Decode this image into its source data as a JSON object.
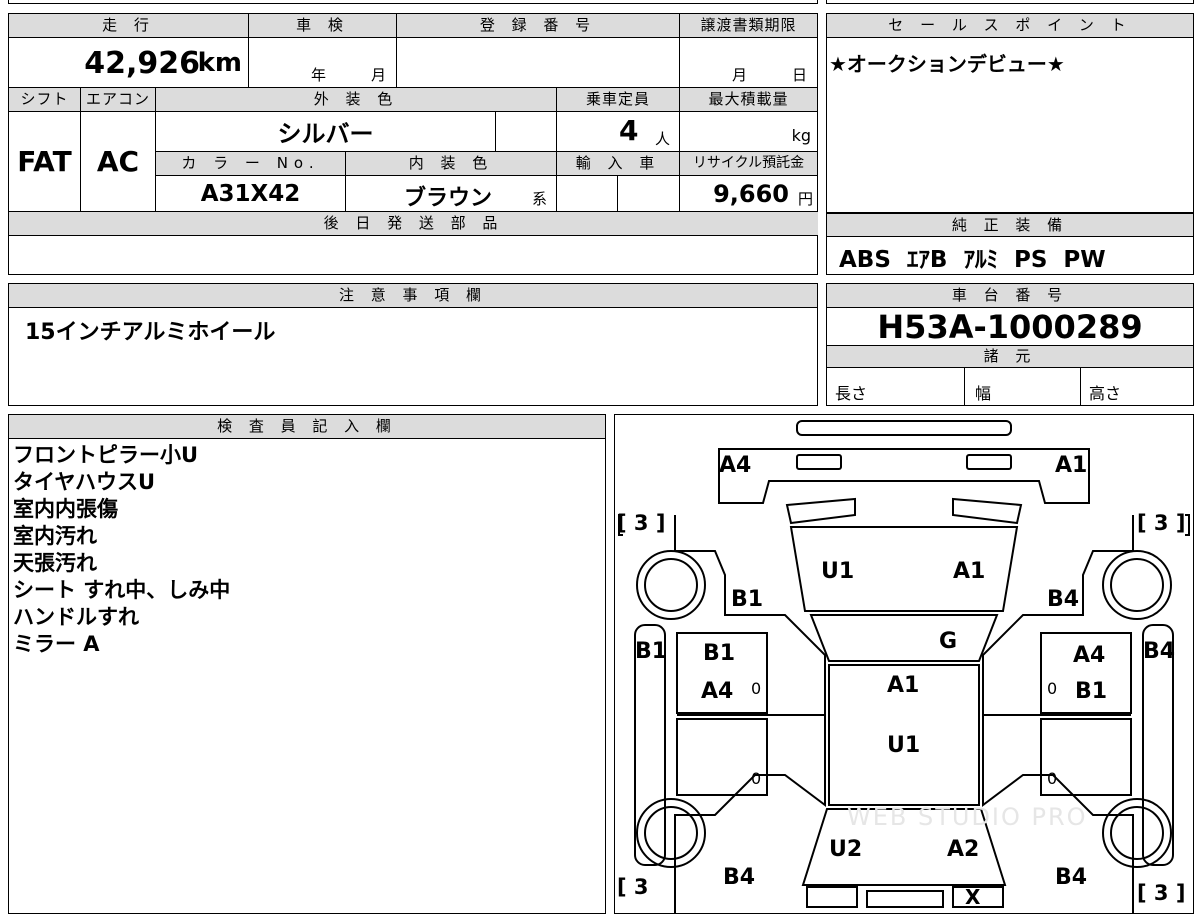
{
  "top_info": {
    "mileage_label": "走 行",
    "mileage": "42,926",
    "mileage_unit": "km",
    "shaken_label": "車 検",
    "year_label": "年",
    "month_label": "月",
    "reg_label": "登 録 番 号",
    "transfer_label": "譲渡書類期限",
    "transfer_month": "月",
    "transfer_day": "日",
    "shift_label": "シフト",
    "shift": "FAT",
    "ac_label": "エアコン",
    "ac": "AC",
    "exterior_label": "外 装 色",
    "exterior_color": "シルバー",
    "capacity_label": "乗車定員",
    "capacity": "4",
    "capacity_unit": "人",
    "max_load_label": "最大積載量",
    "max_load_unit": "kg",
    "color_no_label": "カ ラ ー No.",
    "color_no": "A31X42",
    "interior_label": "内 装 色",
    "interior_color": "ブラウン",
    "interior_suffix": "系",
    "import_label": "輸 入 車",
    "recycle_label": "リサイクル預託金",
    "recycle_fee": "9,660",
    "recycle_unit": "円",
    "later_parts_label": "後 日 発 送 部 品"
  },
  "sales_point": {
    "label": "セ ー ル ス ポ イ ン ト",
    "text": "★オークションデビュー★"
  },
  "standard_equipment": {
    "label": "純 正 装 備",
    "text": "ABS  ｴｱB  ｱﾙﾐ  PS  PW"
  },
  "notes": {
    "label": "注 意 事 項 欄",
    "text": "15インチアルミホイール"
  },
  "chassis": {
    "label": "車 台 番 号",
    "number": "H53A-1000289",
    "spec_label": "諸 元",
    "length_label": "長さ",
    "width_label": "幅",
    "height_label": "高さ"
  },
  "inspector": {
    "label": "検 査 員 記 入 欄",
    "items": [
      "フロントピラー小U",
      "タイヤハウスU",
      "室内内張傷",
      "室内汚れ",
      "天張汚れ",
      "シート すれ中、しみ中",
      "ハンドルすれ",
      "ミラー A"
    ]
  },
  "diagram": {
    "front_left": "A4",
    "front_right": "A1",
    "tread_fl": "[ 3 ]",
    "tread_fr": "[ 3 ]",
    "tread_rl": "[ 3",
    "tread_rr": "[ 3 ]",
    "hood_left": "U1",
    "hood_right": "A1",
    "fender_left": "B1",
    "fender_right": "B4",
    "windshield": "G",
    "pillar_left": "B1",
    "pillar_right": "B4",
    "door_fl_1": "B1",
    "door_fl_2": "A4",
    "door_fr_1": "A4",
    "door_fr_2": "B1",
    "roof_1": "A1",
    "roof_2": "U1",
    "zero_1": "0",
    "zero_2": "0",
    "zero_3": "0",
    "zero_4": "0",
    "trunk_left": "U2",
    "trunk_right": "A2",
    "rear_left": "B4",
    "rear_right": "B4",
    "rear_mark": "X",
    "watermark": "WEB STUDIO PRO"
  }
}
